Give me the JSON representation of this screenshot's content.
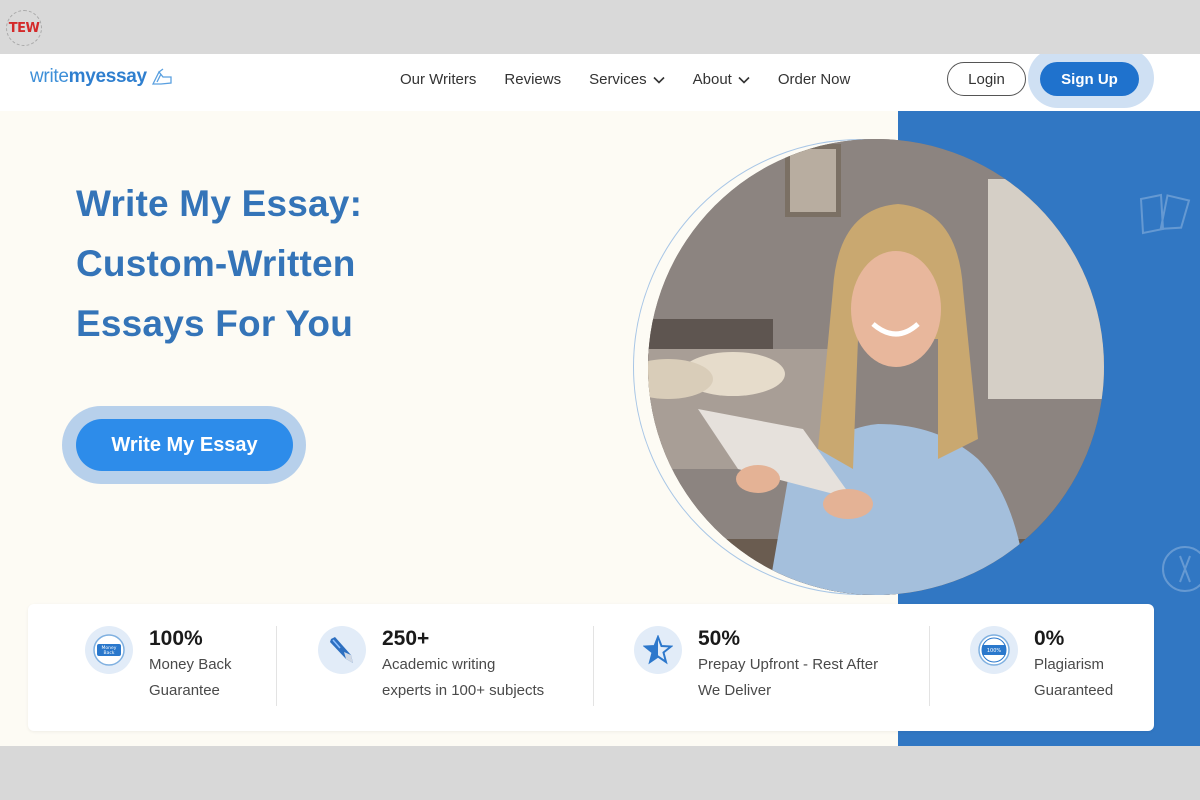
{
  "watermark": {
    "label": "TEW"
  },
  "header": {
    "logo": {
      "part1": "write",
      "part2": "myessay"
    },
    "nav": [
      {
        "label": "Our Writers",
        "dropdown": false
      },
      {
        "label": "Reviews",
        "dropdown": false
      },
      {
        "label": "Services",
        "dropdown": true
      },
      {
        "label": "About",
        "dropdown": true
      },
      {
        "label": "Order Now",
        "dropdown": false
      }
    ],
    "login_label": "Login",
    "signup_label": "Sign Up"
  },
  "hero": {
    "title_lines": [
      "Write My Essay:",
      "Custom-Written",
      "Essays For You"
    ],
    "cta_label": "Write My Essay",
    "image_alt": "woman-reading-paper"
  },
  "stats": [
    {
      "icon": "money-back-badge-icon",
      "value": "100%",
      "desc_lines": [
        "Money Back",
        "Guarantee"
      ]
    },
    {
      "icon": "pen-icon",
      "value": "250+",
      "desc_lines": [
        "Academic writing",
        "experts in 100+ subjects"
      ]
    },
    {
      "icon": "star-icon",
      "value": "50%",
      "desc_lines": [
        "Prepay Upfront - Rest After",
        "We Deliver"
      ]
    },
    {
      "icon": "authentic-badge-icon",
      "value": "0%",
      "desc_lines": [
        "Plagiarism",
        "Guaranteed"
      ]
    }
  ],
  "colors": {
    "brand_blue": "#3177c3",
    "button_blue": "#2d8cea",
    "signup_blue": "#1f72cd",
    "hero_text": "#3474b8",
    "page_bg": "#fdfbf4"
  }
}
